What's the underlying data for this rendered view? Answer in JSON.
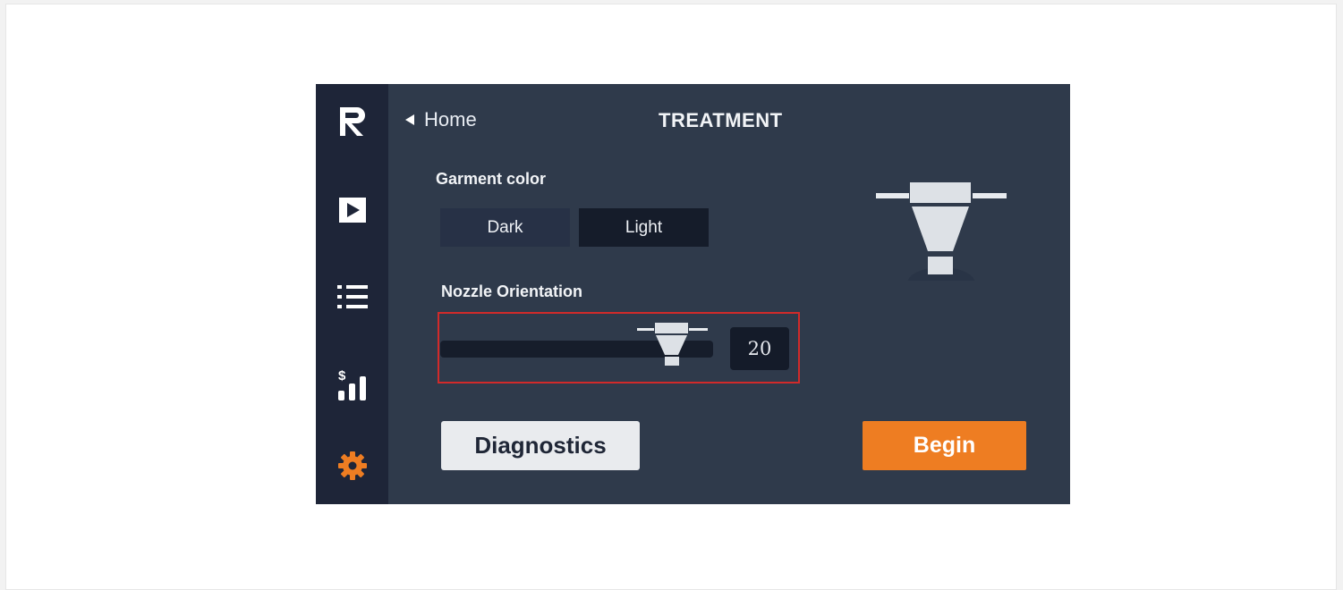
{
  "sidebar": {
    "items": [
      {
        "icon": "brand-logo-icon"
      },
      {
        "icon": "play-icon"
      },
      {
        "icon": "list-icon"
      },
      {
        "icon": "cost-chart-icon",
        "glyph": "$"
      },
      {
        "icon": "gear-icon"
      }
    ],
    "active_color": "#ee7d22"
  },
  "header": {
    "back_label": "Home",
    "title": "TREATMENT"
  },
  "garment_color": {
    "label": "Garment color",
    "options": [
      "Dark",
      "Light"
    ],
    "selected": "Light"
  },
  "nozzle_orientation": {
    "label": "Nozzle Orientation",
    "value": "20",
    "slider_fraction": 0.85
  },
  "actions": {
    "diagnostics_label": "Diagnostics",
    "begin_label": "Begin"
  },
  "colors": {
    "accent": "#ee7d22",
    "panel": "#2f3a4b",
    "sidebar": "#1e2538",
    "highlight": "#d12a2a"
  }
}
